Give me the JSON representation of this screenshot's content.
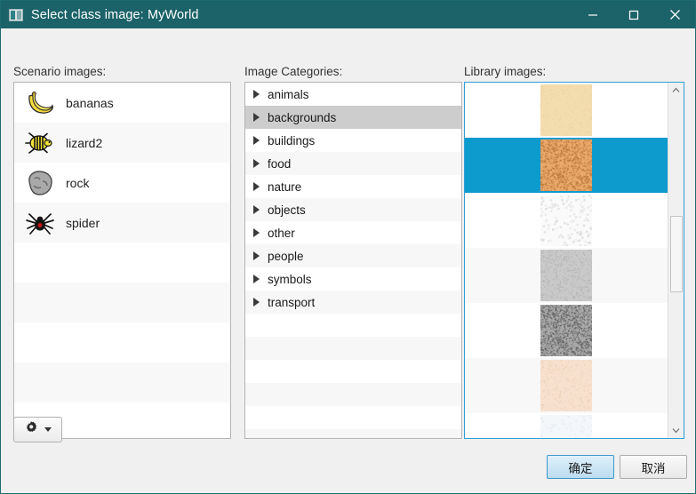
{
  "window": {
    "title": "Select class image: MyWorld",
    "icon": "image-window-icon",
    "controls": [
      {
        "name": "minimize",
        "glyph": "minimize-icon"
      },
      {
        "name": "maximize",
        "glyph": "maximize-icon"
      },
      {
        "name": "close",
        "glyph": "close-icon"
      }
    ],
    "titlebar_color": "#1b6269",
    "background_color": "#f0f0f0"
  },
  "scenario": {
    "label": "Scenario images:",
    "items": [
      {
        "name": "bananas",
        "icon": "bananas-icon"
      },
      {
        "name": "lizard2",
        "icon": "lizard-icon"
      },
      {
        "name": "rock",
        "icon": "rock-icon"
      },
      {
        "name": "spider",
        "icon": "spider-icon"
      }
    ]
  },
  "categories": {
    "label": "Image Categories:",
    "selected": "backgrounds",
    "items": [
      {
        "name": "animals"
      },
      {
        "name": "backgrounds"
      },
      {
        "name": "buildings"
      },
      {
        "name": "food"
      },
      {
        "name": "nature"
      },
      {
        "name": "objects"
      },
      {
        "name": "other"
      },
      {
        "name": "people"
      },
      {
        "name": "symbols"
      },
      {
        "name": "transport"
      }
    ]
  },
  "library": {
    "label": "Library images:",
    "selected_index": 1,
    "selection_color": "#0d9bce",
    "items": [
      {
        "name": "sand-smooth-pale",
        "color": "#f3dcae"
      },
      {
        "name": "sand-grainy-orange",
        "color": "#e8a96a"
      },
      {
        "name": "paper-crumpled-white",
        "color": "#f2f2f2"
      },
      {
        "name": "concrete-light-gray",
        "color": "#c9c9c9"
      },
      {
        "name": "noise-dark-gray",
        "color": "#a8a8a8"
      },
      {
        "name": "wood-pale-peach",
        "color": "#f7e0cd"
      },
      {
        "name": "texture-faint-white",
        "color": "#f4f7fa"
      }
    ],
    "scrollbar": {
      "up_arrow": "chevron-up-icon",
      "down_arrow": "chevron-down-icon"
    }
  },
  "toolbar": {
    "gear_label": "gear-icon",
    "dropdown_label": "chevron-down-icon"
  },
  "dialog_buttons": {
    "ok": "确定",
    "cancel": "取消"
  }
}
